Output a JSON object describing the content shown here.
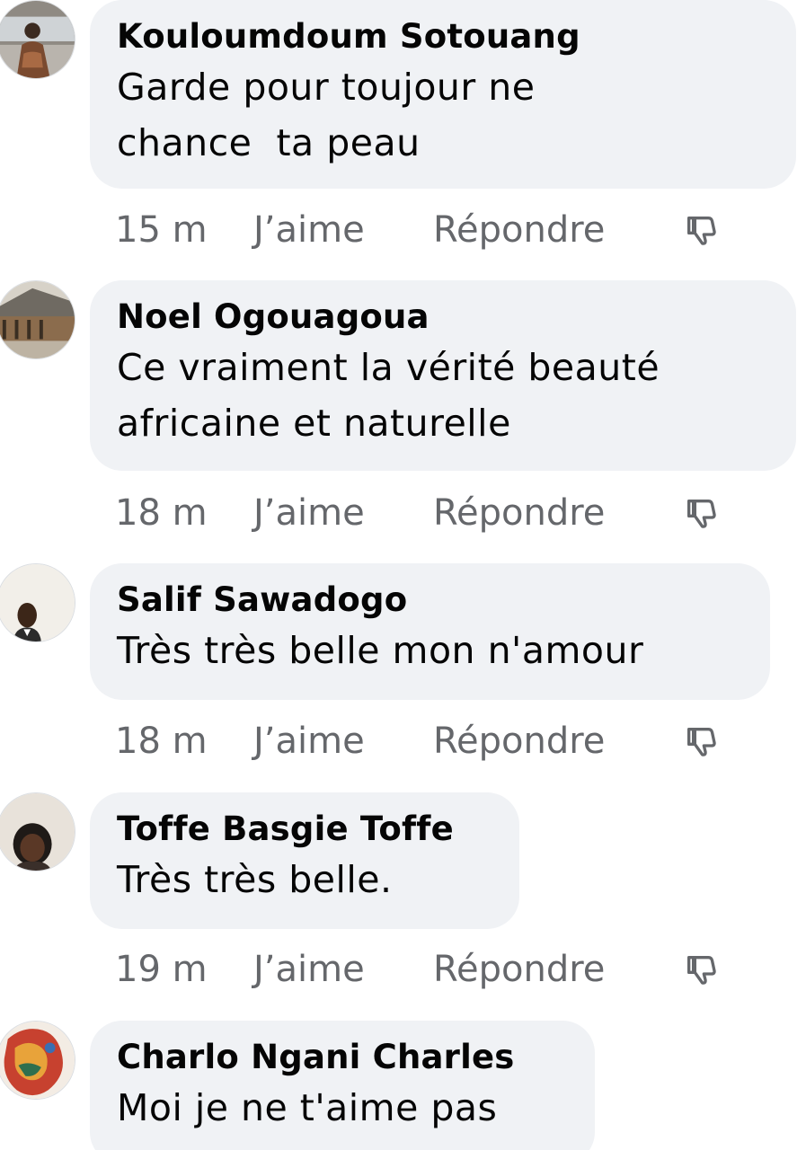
{
  "comments": [
    {
      "author": "Kouloumdoum Sotouang",
      "text": "Garde pour toujour ne\nchance  ta peau",
      "time": "15 m",
      "like_label": "J’aime",
      "reply_label": "Répondre",
      "avatar_icon": "profile-photo"
    },
    {
      "author": "Noel Ogouagoua",
      "text": "Ce vraiment la vérité beauté\nafricaine et naturelle",
      "time": "18 m",
      "like_label": "J’aime",
      "reply_label": "Répondre",
      "avatar_icon": "profile-photo"
    },
    {
      "author": "Salif Sawadogo",
      "text": "Très très belle mon n'amour",
      "time": "18 m",
      "like_label": "J’aime",
      "reply_label": "Répondre",
      "avatar_icon": "profile-photo"
    },
    {
      "author": "Toffe Basgie Toffe",
      "text": "Très très belle.",
      "time": "19 m",
      "like_label": "J’aime",
      "reply_label": "Répondre",
      "avatar_icon": "profile-photo"
    },
    {
      "author": "Charlo Ngani Charles",
      "text": "Moi je ne t'aime pas",
      "avatar_icon": "profile-photo"
    }
  ],
  "colors": {
    "bubble_bg": "#f0f2f5",
    "text": "#050505",
    "meta": "#65676b"
  },
  "icons": {
    "dislike": "thumb-down-icon"
  }
}
